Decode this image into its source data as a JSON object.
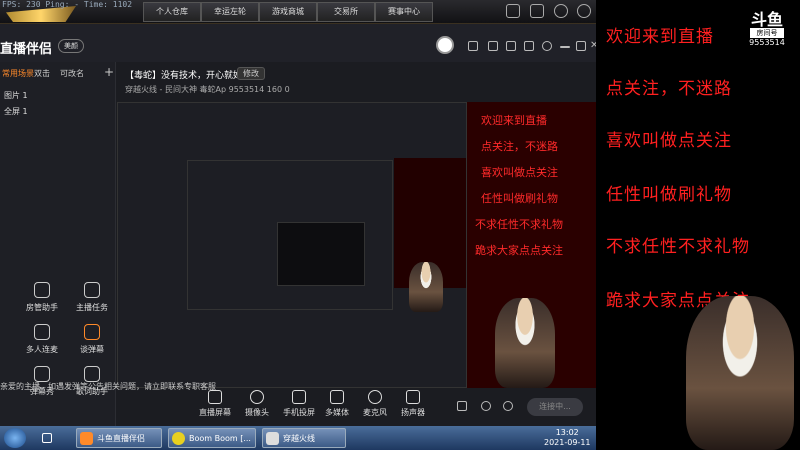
{
  "game_topbar": {
    "fps_text": "FPS: 230  Ping: -    Time: 1102",
    "tabs": [
      "个人仓库",
      "幸运左轮",
      "游戏商城",
      "交易所",
      "赛事中心"
    ],
    "status_icons": [
      "shield-icon",
      "chart-icon",
      "gear-icon",
      "power-icon"
    ]
  },
  "app": {
    "logo": "直播伴侣",
    "stream_button": "美颜",
    "title_icons": [
      "comment-icon",
      "message-icon",
      "filter-icon",
      "skin-icon",
      "settings-icon",
      "minimize-icon",
      "maximize-icon",
      "close-icon"
    ],
    "left_panel": {
      "tabs": [
        "常用场景",
        "双击",
        "可改名"
      ],
      "add_label": "+",
      "scenes": [
        "图片 1",
        "全屏 1"
      ],
      "tools": [
        {
          "label": "房管助手",
          "icon": "gift-icon"
        },
        {
          "label": "主播任务",
          "icon": "task-icon"
        },
        {
          "label": "多人连麦",
          "icon": "download-icon"
        },
        {
          "label": "谈弹幕",
          "icon": "danmaku-icon"
        },
        {
          "label": "弹幕秀",
          "icon": "tv-icon"
        },
        {
          "label": "歌词助手",
          "icon": "music-icon"
        }
      ],
      "notice": "亲爱的主播，如遇发弹等公告相关问题，请立即联系专职客服"
    },
    "main": {
      "room_title": "【毒蛇】没有技术，开心就好",
      "edit_label": "修改",
      "room_meta": "穿越火线 - 民间大神   毒蛇Ap 9553514   160   0",
      "preview_overlay_lines": [
        "欢迎来到直播",
        "点关注，不迷路",
        "喜欢叫做点关注",
        "任性叫做刷礼物",
        "不求任性不求礼物",
        "跪求大家点点关注"
      ],
      "bottom_tools": [
        "直播屏幕",
        "摄像头",
        "手机投屏",
        "多媒体",
        "麦克风",
        "扬声器"
      ],
      "connect_button": "连接中..."
    }
  },
  "taskbar": {
    "tasks": [
      "斗鱼直播伴侣",
      "Boom  Boom [...",
      "穿越火线"
    ],
    "time": "13:02",
    "date": "2021-09-11"
  },
  "overlay": {
    "lines": [
      "欢迎来到直播",
      "点关注，不迷路",
      "喜欢叫做点关注",
      "任性叫做刷礼物",
      "不求任性不求礼物",
      "跪求大家点点关注"
    ],
    "logo_mark": "斗鱼",
    "room_label": "房间号",
    "room_number": "9553514"
  }
}
